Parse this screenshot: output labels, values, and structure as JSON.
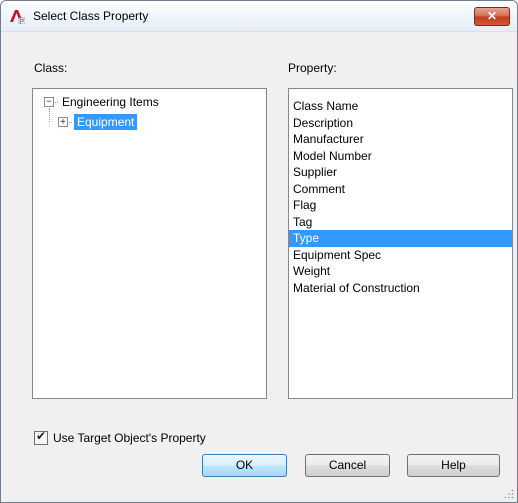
{
  "window": {
    "title": "Select Class Property",
    "close_glyph": "✕",
    "icon": "autocad-plant-icon"
  },
  "class_section": {
    "label": "Class:",
    "tree": {
      "root": {
        "label": "Engineering Items",
        "expander": "−"
      },
      "child": {
        "label": "Equipment",
        "expander": "+",
        "selected": true
      }
    }
  },
  "property_section": {
    "label": "Property:",
    "items": [
      "Class Name",
      "Description",
      "Manufacturer",
      "Model Number",
      "Supplier",
      "Comment",
      "Flag",
      "Tag",
      "Type",
      "Equipment Spec",
      "Weight",
      "Material of Construction"
    ],
    "selected_item": "Type"
  },
  "options": {
    "use_target_label": "Use Target Object's Property",
    "use_target_checked": true
  },
  "buttons": {
    "ok": "OK",
    "cancel": "Cancel",
    "help": "Help"
  },
  "colors": {
    "selection": "#3399ff",
    "dialog_bg": "#f0f0f0",
    "close_red": "#c0391f"
  }
}
